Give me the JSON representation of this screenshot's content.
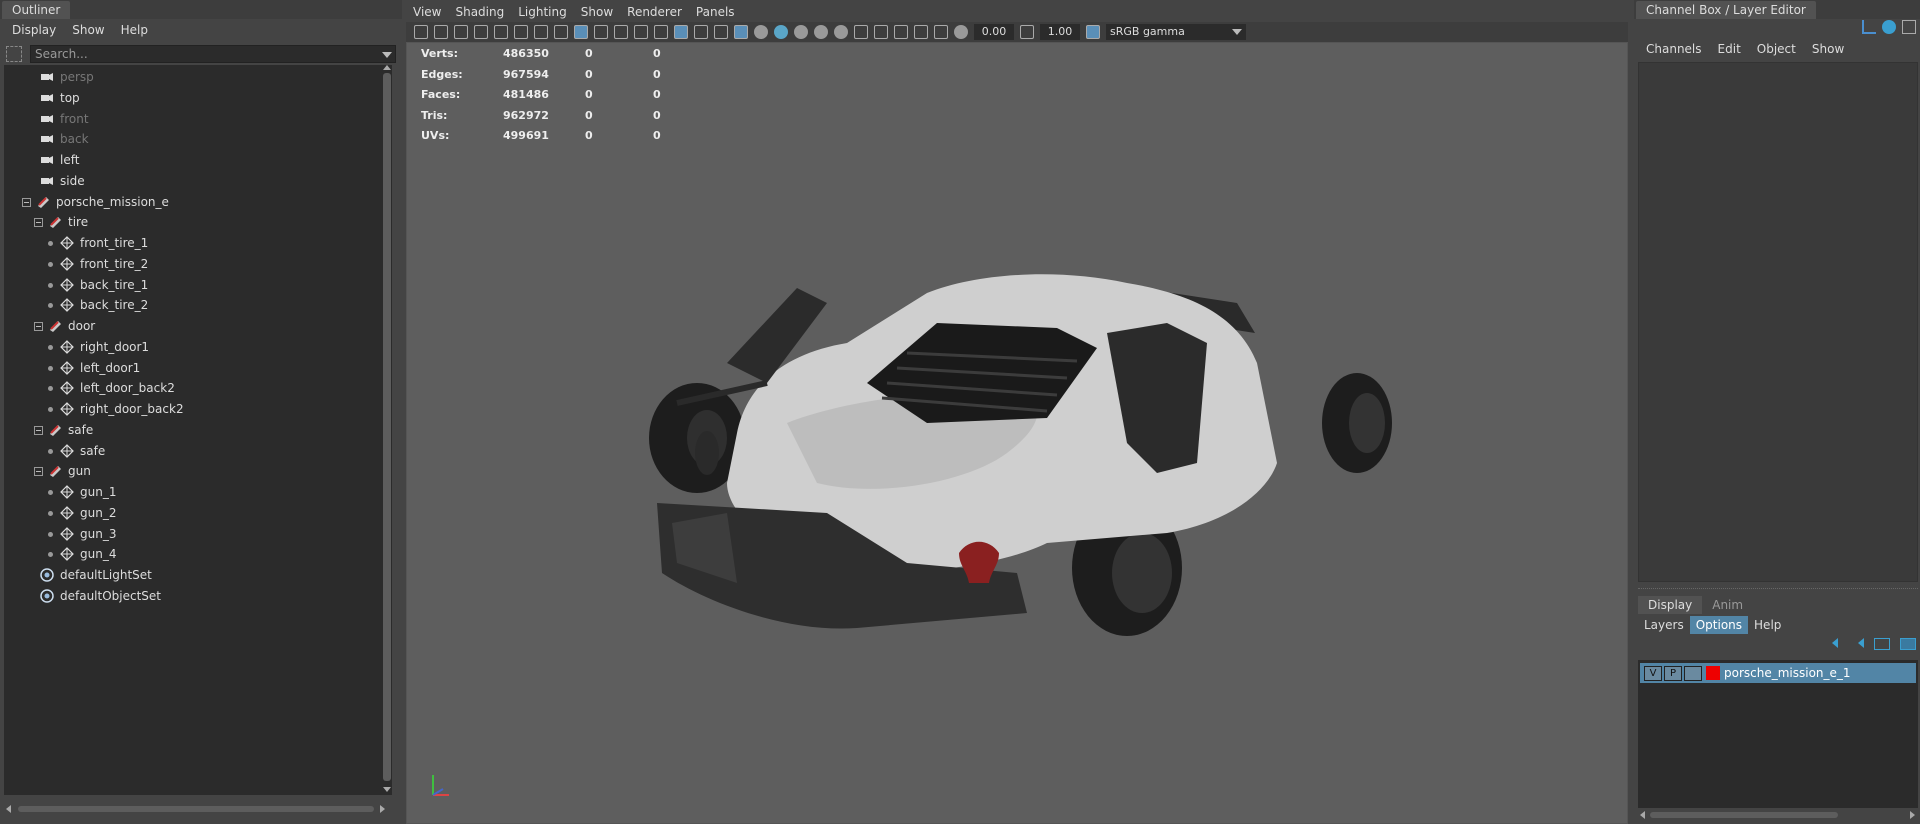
{
  "outliner": {
    "title": "Outliner",
    "menu": [
      "Display",
      "Show",
      "Help"
    ],
    "search_placeholder": "Search...",
    "items": [
      {
        "label": "persp",
        "icon": "camera-icon",
        "dim": true
      },
      {
        "label": "top",
        "icon": "camera-icon",
        "dim": false
      },
      {
        "label": "front",
        "icon": "camera-icon",
        "dim": true
      },
      {
        "label": "back",
        "icon": "camera-icon",
        "dim": true
      },
      {
        "label": "left",
        "icon": "camera-icon",
        "dim": false
      },
      {
        "label": "side",
        "icon": "camera-icon",
        "dim": false
      },
      {
        "label": "porsche_mission_e",
        "icon": "group-icon",
        "dim": false
      },
      {
        "label": "tire",
        "icon": "group-icon",
        "dim": false
      },
      {
        "label": "front_tire_1",
        "icon": "mesh-icon",
        "dim": false
      },
      {
        "label": "front_tire_2",
        "icon": "mesh-icon",
        "dim": false
      },
      {
        "label": "back_tire_1",
        "icon": "mesh-icon",
        "dim": false
      },
      {
        "label": "back_tire_2",
        "icon": "mesh-icon",
        "dim": false
      },
      {
        "label": "door",
        "icon": "group-icon",
        "dim": false
      },
      {
        "label": "right_door1",
        "icon": "mesh-icon",
        "dim": false
      },
      {
        "label": "left_door1",
        "icon": "mesh-icon",
        "dim": false
      },
      {
        "label": "left_door_back2",
        "icon": "mesh-icon",
        "dim": false
      },
      {
        "label": "right_door_back2",
        "icon": "mesh-icon",
        "dim": false
      },
      {
        "label": "safe",
        "icon": "group-icon",
        "dim": false
      },
      {
        "label": "safe",
        "icon": "mesh-icon",
        "dim": false
      },
      {
        "label": "gun",
        "icon": "group-icon",
        "dim": false
      },
      {
        "label": "gun_1",
        "icon": "mesh-icon",
        "dim": false
      },
      {
        "label": "gun_2",
        "icon": "mesh-icon",
        "dim": false
      },
      {
        "label": "gun_3",
        "icon": "mesh-icon",
        "dim": false
      },
      {
        "label": "gun_4",
        "icon": "mesh-icon",
        "dim": false
      },
      {
        "label": "defaultLightSet",
        "icon": "set-icon",
        "dim": false
      },
      {
        "label": "defaultObjectSet",
        "icon": "set-icon",
        "dim": false
      }
    ]
  },
  "viewport": {
    "menu": [
      "View",
      "Shading",
      "Lighting",
      "Show",
      "Renderer",
      "Panels"
    ],
    "exposure": "0.00",
    "gamma": "1.00",
    "color_space": "sRGB gamma",
    "hud": [
      {
        "label": "Verts:",
        "v1": "486350",
        "v2": "0",
        "v3": "0"
      },
      {
        "label": "Edges:",
        "v1": "967594",
        "v2": "0",
        "v3": "0"
      },
      {
        "label": "Faces:",
        "v1": "481486",
        "v2": "0",
        "v3": "0"
      },
      {
        "label": "Tris:",
        "v1": "962972",
        "v2": "0",
        "v3": "0"
      },
      {
        "label": "UVs:",
        "v1": "499691",
        "v2": "0",
        "v3": "0"
      }
    ]
  },
  "channel_box": {
    "title": "Channel Box / Layer Editor",
    "menu": [
      "Channels",
      "Edit",
      "Object",
      "Show"
    ],
    "tabs": [
      "Display",
      "Anim"
    ],
    "layer_menu": [
      "Layers",
      "Options",
      "Help"
    ],
    "layer": {
      "v": "V",
      "p": "P",
      "name": "porsche_mission_e_1",
      "color": "#e00000"
    }
  },
  "colors": {
    "accent": "#5285a6",
    "panel": "#444444",
    "field": "#2b2b2b"
  }
}
